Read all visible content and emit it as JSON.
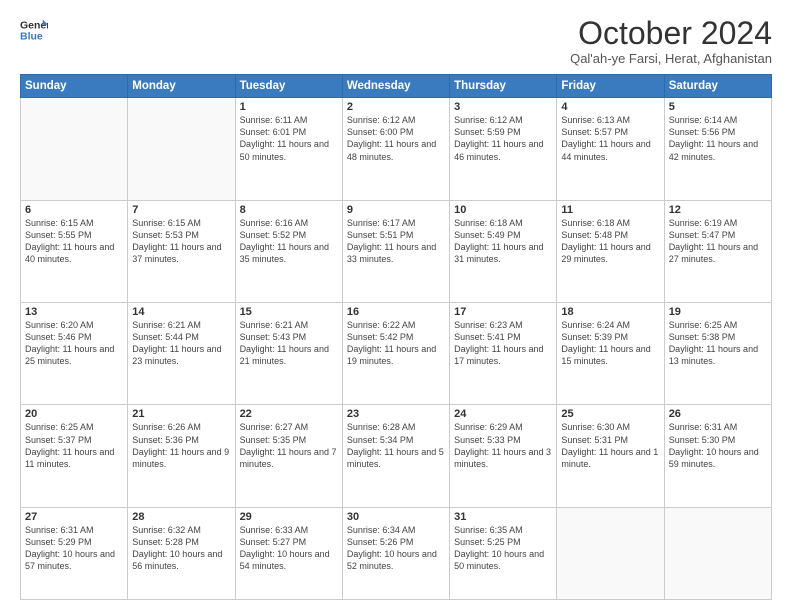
{
  "header": {
    "logo_line1": "General",
    "logo_line2": "Blue",
    "title": "October 2024",
    "subtitle": "Qal'ah-ye Farsi, Herat, Afghanistan"
  },
  "weekdays": [
    "Sunday",
    "Monday",
    "Tuesday",
    "Wednesday",
    "Thursday",
    "Friday",
    "Saturday"
  ],
  "weeks": [
    [
      {
        "day": "",
        "info": ""
      },
      {
        "day": "",
        "info": ""
      },
      {
        "day": "1",
        "info": "Sunrise: 6:11 AM\nSunset: 6:01 PM\nDaylight: 11 hours and 50 minutes."
      },
      {
        "day": "2",
        "info": "Sunrise: 6:12 AM\nSunset: 6:00 PM\nDaylight: 11 hours and 48 minutes."
      },
      {
        "day": "3",
        "info": "Sunrise: 6:12 AM\nSunset: 5:59 PM\nDaylight: 11 hours and 46 minutes."
      },
      {
        "day": "4",
        "info": "Sunrise: 6:13 AM\nSunset: 5:57 PM\nDaylight: 11 hours and 44 minutes."
      },
      {
        "day": "5",
        "info": "Sunrise: 6:14 AM\nSunset: 5:56 PM\nDaylight: 11 hours and 42 minutes."
      }
    ],
    [
      {
        "day": "6",
        "info": "Sunrise: 6:15 AM\nSunset: 5:55 PM\nDaylight: 11 hours and 40 minutes."
      },
      {
        "day": "7",
        "info": "Sunrise: 6:15 AM\nSunset: 5:53 PM\nDaylight: 11 hours and 37 minutes."
      },
      {
        "day": "8",
        "info": "Sunrise: 6:16 AM\nSunset: 5:52 PM\nDaylight: 11 hours and 35 minutes."
      },
      {
        "day": "9",
        "info": "Sunrise: 6:17 AM\nSunset: 5:51 PM\nDaylight: 11 hours and 33 minutes."
      },
      {
        "day": "10",
        "info": "Sunrise: 6:18 AM\nSunset: 5:49 PM\nDaylight: 11 hours and 31 minutes."
      },
      {
        "day": "11",
        "info": "Sunrise: 6:18 AM\nSunset: 5:48 PM\nDaylight: 11 hours and 29 minutes."
      },
      {
        "day": "12",
        "info": "Sunrise: 6:19 AM\nSunset: 5:47 PM\nDaylight: 11 hours and 27 minutes."
      }
    ],
    [
      {
        "day": "13",
        "info": "Sunrise: 6:20 AM\nSunset: 5:46 PM\nDaylight: 11 hours and 25 minutes."
      },
      {
        "day": "14",
        "info": "Sunrise: 6:21 AM\nSunset: 5:44 PM\nDaylight: 11 hours and 23 minutes."
      },
      {
        "day": "15",
        "info": "Sunrise: 6:21 AM\nSunset: 5:43 PM\nDaylight: 11 hours and 21 minutes."
      },
      {
        "day": "16",
        "info": "Sunrise: 6:22 AM\nSunset: 5:42 PM\nDaylight: 11 hours and 19 minutes."
      },
      {
        "day": "17",
        "info": "Sunrise: 6:23 AM\nSunset: 5:41 PM\nDaylight: 11 hours and 17 minutes."
      },
      {
        "day": "18",
        "info": "Sunrise: 6:24 AM\nSunset: 5:39 PM\nDaylight: 11 hours and 15 minutes."
      },
      {
        "day": "19",
        "info": "Sunrise: 6:25 AM\nSunset: 5:38 PM\nDaylight: 11 hours and 13 minutes."
      }
    ],
    [
      {
        "day": "20",
        "info": "Sunrise: 6:25 AM\nSunset: 5:37 PM\nDaylight: 11 hours and 11 minutes."
      },
      {
        "day": "21",
        "info": "Sunrise: 6:26 AM\nSunset: 5:36 PM\nDaylight: 11 hours and 9 minutes."
      },
      {
        "day": "22",
        "info": "Sunrise: 6:27 AM\nSunset: 5:35 PM\nDaylight: 11 hours and 7 minutes."
      },
      {
        "day": "23",
        "info": "Sunrise: 6:28 AM\nSunset: 5:34 PM\nDaylight: 11 hours and 5 minutes."
      },
      {
        "day": "24",
        "info": "Sunrise: 6:29 AM\nSunset: 5:33 PM\nDaylight: 11 hours and 3 minutes."
      },
      {
        "day": "25",
        "info": "Sunrise: 6:30 AM\nSunset: 5:31 PM\nDaylight: 11 hours and 1 minute."
      },
      {
        "day": "26",
        "info": "Sunrise: 6:31 AM\nSunset: 5:30 PM\nDaylight: 10 hours and 59 minutes."
      }
    ],
    [
      {
        "day": "27",
        "info": "Sunrise: 6:31 AM\nSunset: 5:29 PM\nDaylight: 10 hours and 57 minutes."
      },
      {
        "day": "28",
        "info": "Sunrise: 6:32 AM\nSunset: 5:28 PM\nDaylight: 10 hours and 56 minutes."
      },
      {
        "day": "29",
        "info": "Sunrise: 6:33 AM\nSunset: 5:27 PM\nDaylight: 10 hours and 54 minutes."
      },
      {
        "day": "30",
        "info": "Sunrise: 6:34 AM\nSunset: 5:26 PM\nDaylight: 10 hours and 52 minutes."
      },
      {
        "day": "31",
        "info": "Sunrise: 6:35 AM\nSunset: 5:25 PM\nDaylight: 10 hours and 50 minutes."
      },
      {
        "day": "",
        "info": ""
      },
      {
        "day": "",
        "info": ""
      }
    ]
  ]
}
